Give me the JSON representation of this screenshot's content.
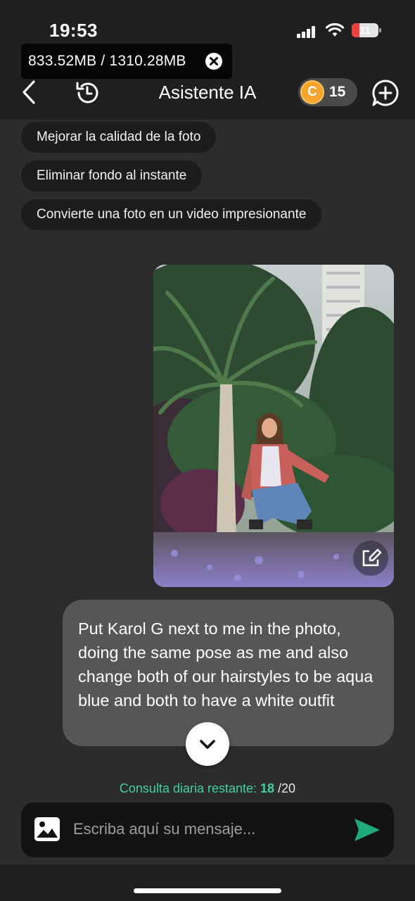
{
  "status_bar": {
    "time": "19:53",
    "battery_level": "11",
    "battery_color": "#e7433c"
  },
  "memory": {
    "text": "833.52MB / 1310.28MB"
  },
  "header": {
    "title": "Asistente IA",
    "coin_symbol": "C",
    "coin_count": "15"
  },
  "suggestions": [
    {
      "label": "Mejorar la calidad de la foto"
    },
    {
      "label": "Eliminar fondo al instante"
    },
    {
      "label": "Convierte una foto en un video impresionante"
    }
  ],
  "messages": [
    {
      "type": "image",
      "icon": "edit-icon"
    },
    {
      "type": "text",
      "text": "Put Karol G next to me in the photo, doing the same pose as me and also change both of our hairstyles to be aqua blue and both to have a white outfit"
    }
  ],
  "quota": {
    "label": "Consulta diaria restante: ",
    "remaining": "18",
    "total": " /20",
    "accent": "#3fd0a2"
  },
  "composer": {
    "placeholder": "Escriba aquí su mensaje...",
    "send_color": "#1faa7a"
  },
  "colors": {
    "background": "#2c2c2c",
    "header": "#1f1f1f",
    "chip": "#1c1c1c",
    "bubble": "#565656",
    "coin": "#f5a42c"
  }
}
